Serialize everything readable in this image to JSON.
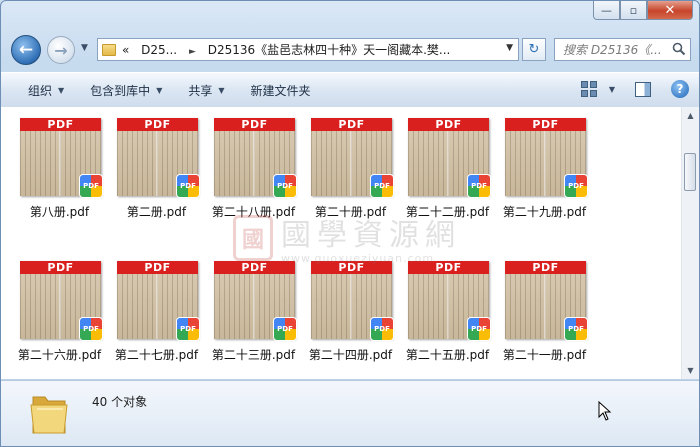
{
  "window": {
    "caption": {
      "minimize": "—",
      "maximize": "▫",
      "close": "✕"
    }
  },
  "nav": {
    "back": "←",
    "forward": "→",
    "address_parts": [
      "«",
      "D25...",
      "D25136《盐邑志林四十种》天一阁藏本.樊..."
    ],
    "search_placeholder": "搜索 D25136《...",
    "refresh": "↻"
  },
  "toolbar": {
    "organize": "组织",
    "include_in_library": "包含到库中",
    "share": "共享",
    "new_folder": "新建文件夹",
    "help": "?"
  },
  "files": [
    {
      "name": "第八册.pdf",
      "band": "PDF",
      "badge": "PDF"
    },
    {
      "name": "第二册.pdf",
      "band": "PDF",
      "badge": "PDF"
    },
    {
      "name": "第二十八册.pdf",
      "band": "PDF",
      "badge": "PDF"
    },
    {
      "name": "第二十册.pdf",
      "band": "PDF",
      "badge": "PDF"
    },
    {
      "name": "第二十二册.pdf",
      "band": "PDF",
      "badge": "PDF"
    },
    {
      "name": "第二十九册.pdf",
      "band": "PDF",
      "badge": "PDF"
    },
    {
      "name": "第二十六册.pdf",
      "band": "PDF",
      "badge": "PDF"
    },
    {
      "name": "第二十七册.pdf",
      "band": "PDF",
      "badge": "PDF"
    },
    {
      "name": "第二十三册.pdf",
      "band": "PDF",
      "badge": "PDF"
    },
    {
      "name": "第二十四册.pdf",
      "band": "PDF",
      "badge": "PDF"
    },
    {
      "name": "第二十五册.pdf",
      "band": "PDF",
      "badge": "PDF"
    },
    {
      "name": "第二十一册.pdf",
      "band": "PDF",
      "badge": "PDF"
    }
  ],
  "watermark": {
    "seal": "國",
    "text": "國學資源網",
    "url": "www.guoxueziyuan.com"
  },
  "details": {
    "item_count": "40 个对象"
  }
}
